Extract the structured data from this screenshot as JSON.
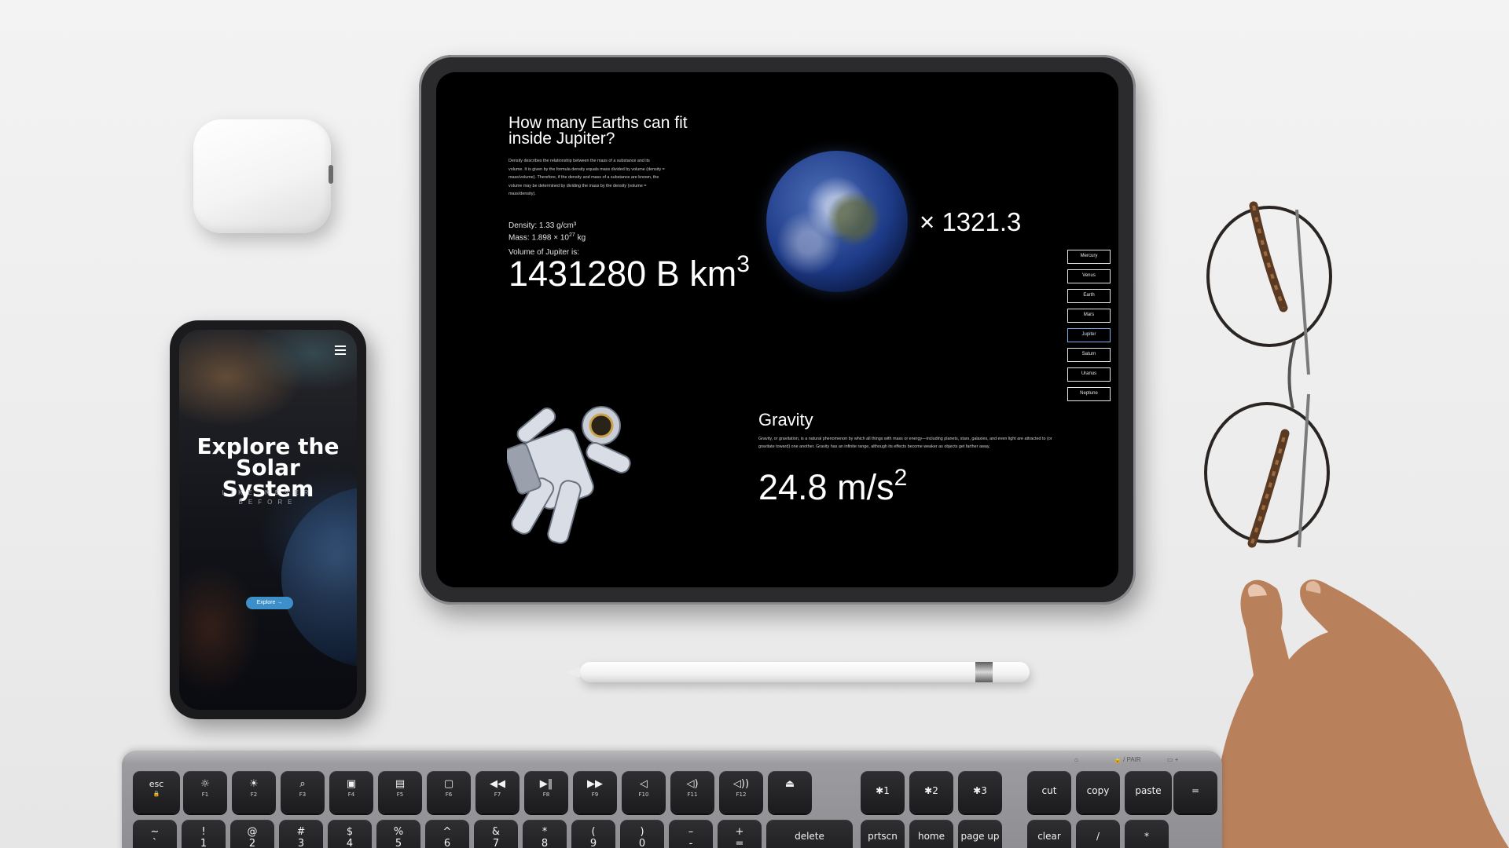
{
  "tablet": {
    "heading": "How many Earths can fit inside Jupiter?",
    "description": "Density describes the relationship between the mass of a substance and its volume. It is given by the formula density equals mass divided by volume (density = mass/volume). Therefore, if the density and mass of a substance are known, the volume may be determined by dividing the mass by the density (volume = mass/density).",
    "density": "Density: 1.33 g/cm³",
    "mass_prefix": "Mass: 1.898 × 10",
    "mass_exponent": "27",
    "mass_unit": "kg",
    "volume_label": "Volume of Jupiter is:",
    "volume_value": "1431280 B km",
    "volume_exponent": "3",
    "multiplier": "× 1321.3",
    "planets": [
      "Mercury",
      "Venus",
      "Earth",
      "Mars",
      "Jupiter",
      "Saturn",
      "Uranus",
      "Neptune"
    ],
    "active_planet": "Jupiter",
    "gravity_title": "Gravity",
    "gravity_description": "Gravity, or gravitation, is a natural phenomenon by which all things with mass or energy—including planets, stars, galaxies, and even light are attracted to (or gravitate toward) one another. Gravity has an infinite range, although its effects become weaker as objects get farther away.",
    "gravity_value": "24.8 m/s",
    "gravity_exponent": "2"
  },
  "phone": {
    "title": "Explore the Solar System",
    "subtitle": "LIKE NEVER BEFORE",
    "button": "Explore →"
  },
  "keyboard": {
    "indicators": [
      "⌂",
      "🔒 / PAIR",
      "▭ +"
    ],
    "row1": [
      {
        "name": "esc",
        "label": "esc",
        "icon": "🔒"
      },
      {
        "name": "f1",
        "icon": "☼",
        "sub": "F1"
      },
      {
        "name": "f2",
        "icon": "☀",
        "sub": "F2"
      },
      {
        "name": "f3",
        "icon": "⌕",
        "sub": "F3"
      },
      {
        "name": "f4",
        "icon": "▣",
        "sub": "F4"
      },
      {
        "name": "f5",
        "icon": "▤",
        "sub": "F5"
      },
      {
        "name": "f6",
        "icon": "▢",
        "sub": "F6"
      },
      {
        "name": "f7",
        "icon": "◀◀",
        "sub": "F7"
      },
      {
        "name": "f8",
        "icon": "▶‖",
        "sub": "F8"
      },
      {
        "name": "f9",
        "icon": "▶▶",
        "sub": "F9"
      },
      {
        "name": "f10",
        "icon": "◁",
        "sub": "F10"
      },
      {
        "name": "f11",
        "icon": "◁)",
        "sub": "F11"
      },
      {
        "name": "f12",
        "icon": "◁))",
        "sub": "F12"
      },
      {
        "name": "eject",
        "icon": "⏏"
      },
      {
        "name": "bt1",
        "label": "✱1"
      },
      {
        "name": "bt2",
        "label": "✱2"
      },
      {
        "name": "bt3",
        "label": "✱3"
      },
      {
        "name": "cut",
        "label": "cut"
      },
      {
        "name": "copy",
        "label": "copy"
      },
      {
        "name": "paste",
        "label": "paste"
      },
      {
        "name": "equals",
        "label": "="
      }
    ],
    "row2": [
      {
        "name": "tilde",
        "top": "~",
        "bottom": "`"
      },
      {
        "name": "1",
        "top": "!",
        "bottom": "1"
      },
      {
        "name": "2",
        "top": "@",
        "bottom": "2"
      },
      {
        "name": "3",
        "top": "#",
        "bottom": "3"
      },
      {
        "name": "4",
        "top": "$",
        "bottom": "4"
      },
      {
        "name": "5",
        "top": "%",
        "bottom": "5"
      },
      {
        "name": "6",
        "top": "^",
        "bottom": "6"
      },
      {
        "name": "7",
        "top": "&",
        "bottom": "7"
      },
      {
        "name": "8",
        "top": "*",
        "bottom": "8"
      },
      {
        "name": "9",
        "top": "(",
        "bottom": "9"
      },
      {
        "name": "0",
        "top": ")",
        "bottom": "0"
      },
      {
        "name": "minus",
        "top": "–",
        "bottom": "-"
      },
      {
        "name": "plus",
        "top": "+",
        "bottom": "="
      },
      {
        "name": "delete",
        "label": "delete"
      },
      {
        "name": "prtscn",
        "label": "prtscn"
      },
      {
        "name": "home",
        "label": "home"
      },
      {
        "name": "pageup",
        "label": "page up"
      },
      {
        "name": "clear",
        "label": "clear"
      },
      {
        "name": "slash",
        "label": "/"
      },
      {
        "name": "asterisk",
        "label": "*"
      }
    ]
  },
  "colors": {
    "tablet_screen": "#000000",
    "active_planet_border": "#7fb0e8",
    "phone_button": "#3c8fc9",
    "key_cap": "#1e1e20"
  }
}
